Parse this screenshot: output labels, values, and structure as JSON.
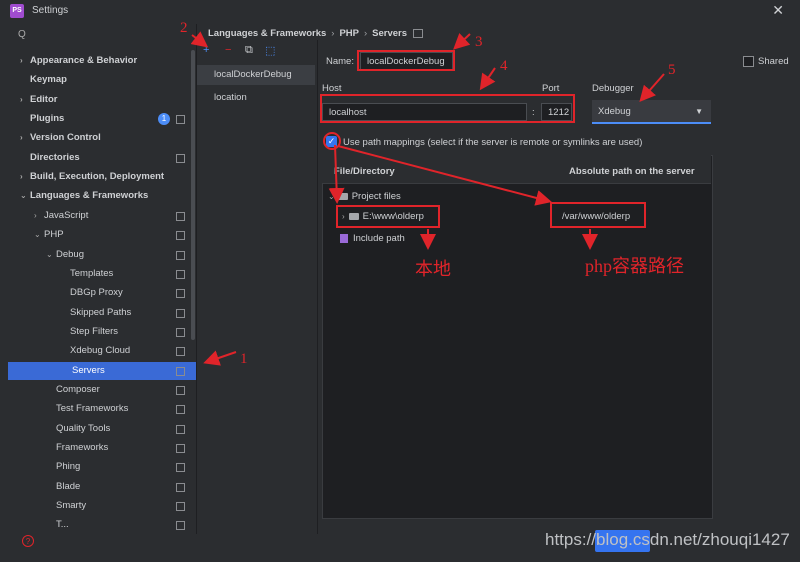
{
  "window": {
    "title": "Settings",
    "logo": "PS"
  },
  "search": {
    "placeholder": "Q"
  },
  "sidebar": {
    "items": [
      {
        "label": "Appearance & Behavior",
        "level": 0,
        "chevron": "›",
        "bold": true
      },
      {
        "label": "Keymap",
        "level": 0,
        "chevron": "",
        "bold": true
      },
      {
        "label": "Editor",
        "level": 0,
        "chevron": "›",
        "bold": true
      },
      {
        "label": "Plugins",
        "level": 0,
        "chevron": "",
        "bold": true,
        "badge": "1"
      },
      {
        "label": "Version Control",
        "level": 0,
        "chevron": "›",
        "bold": true
      },
      {
        "label": "Directories",
        "level": 0,
        "chevron": "",
        "bold": true
      },
      {
        "label": "Build, Execution, Deployment",
        "level": 0,
        "chevron": "›",
        "bold": true
      },
      {
        "label": "Languages & Frameworks",
        "level": 0,
        "chevron": "⌄",
        "bold": true
      },
      {
        "label": "JavaScript",
        "level": 1,
        "chevron": "›"
      },
      {
        "label": "PHP",
        "level": 1,
        "chevron": "⌄"
      },
      {
        "label": "Debug",
        "level": 2,
        "chevron": "⌄"
      },
      {
        "label": "Templates",
        "level": 3
      },
      {
        "label": "DBGp Proxy",
        "level": 3
      },
      {
        "label": "Skipped Paths",
        "level": 3
      },
      {
        "label": "Step Filters",
        "level": 3
      },
      {
        "label": "Xdebug Cloud",
        "level": 3
      },
      {
        "label": "Servers",
        "level": 2,
        "selected": true
      },
      {
        "label": "Composer",
        "level": 2
      },
      {
        "label": "Test Frameworks",
        "level": 2
      },
      {
        "label": "Quality Tools",
        "level": 2
      },
      {
        "label": "Frameworks",
        "level": 2
      },
      {
        "label": "Phing",
        "level": 2
      },
      {
        "label": "Blade",
        "level": 2
      },
      {
        "label": "Smarty",
        "level": 2
      },
      {
        "label": "T...",
        "level": 2
      }
    ]
  },
  "toolbar": {
    "add": "+",
    "remove": "−",
    "copy": "⧉",
    "import": "⬚"
  },
  "servers": [
    "localDockerDebug",
    "location"
  ],
  "breadcrumb": {
    "part1": "Languages & Frameworks",
    "sep": "›",
    "part2": "PHP",
    "part3": "Servers"
  },
  "form": {
    "name_label": "Name:",
    "name_value": "localDockerDebug",
    "shared_label": "Shared",
    "host_label": "Host",
    "host_value": "localhost",
    "port_label": "Port",
    "port_sep": ":",
    "port_value": "1212",
    "debugger_label": "Debugger",
    "debugger_value": "Xdebug",
    "path_mapping_label": "Use path mappings (select if the server is remote or symlinks are used)"
  },
  "mappings": {
    "col_file": "File/Directory",
    "col_abs": "Absolute path on the server",
    "project_files": "Project files",
    "local_path": "E:\\www\\olderp",
    "server_path": "/var/www/olderp",
    "include_path": "Include path"
  },
  "annotations": {
    "n1": "1",
    "n2": "2",
    "n3": "3",
    "n4": "4",
    "n5": "5",
    "local_label": "本地",
    "server_label": "php容器路径"
  },
  "footer": {
    "watermark": "https://blog.csdn.net/zhouqi1427"
  },
  "colors": {
    "accent": "#3574f0",
    "annotation": "#e0242a",
    "selection": "#3a6ad6"
  }
}
